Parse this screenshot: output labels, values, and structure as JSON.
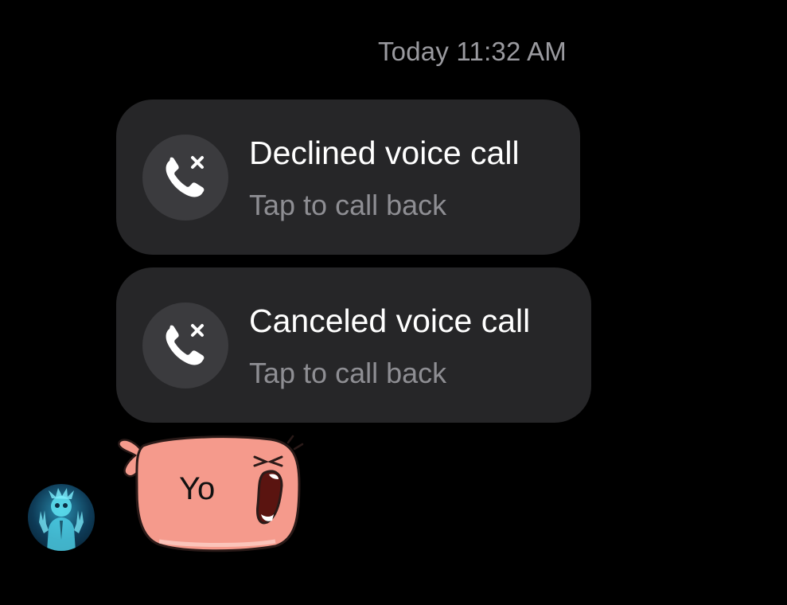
{
  "header": {
    "timestamp": "Today 11:32 AM"
  },
  "messages": {
    "calls": [
      {
        "title": "Declined voice call",
        "subtitle": "Tap to call back",
        "icon": "missed-call-icon"
      },
      {
        "title": "Canceled voice call",
        "subtitle": "Tap to call back",
        "icon": "missed-call-icon"
      }
    ],
    "sticker": {
      "text": "Yo"
    }
  },
  "colors": {
    "background": "#000000",
    "card_background": "#262628",
    "icon_circle": "#3b3b3e",
    "title_text": "#ffffff",
    "subtitle_text": "#8e8e93",
    "timestamp_text": "#9a9a9f",
    "sticker_fill": "#f59a8c"
  }
}
